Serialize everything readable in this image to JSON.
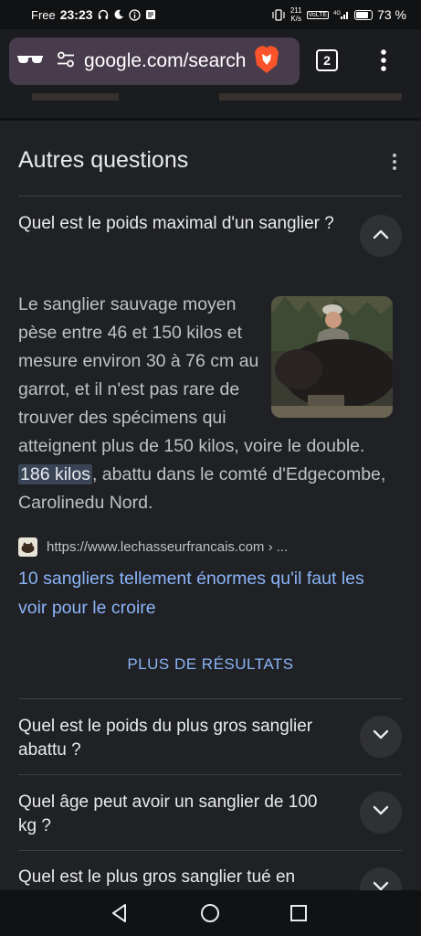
{
  "status_bar": {
    "carrier": "Free",
    "time": "23:23",
    "net_speed_value": "211",
    "net_speed_unit": "K/s",
    "volte": "VoLTE",
    "signal_type": "4G",
    "battery": "73 %"
  },
  "browser": {
    "url": "google.com/search",
    "tab_count": "2"
  },
  "section": {
    "title": "Autres questions"
  },
  "expanded_question": {
    "question": "Quel est le poids maximal d'un sanglier ?",
    "answer_part1": "Le sanglier sauvage moyen pèse entre 46 et 150 kilos et mesure environ 30 à 76 cm au garrot, et il n'est pas rare de trouver des spécimens qui atteignent plus de 150 kilos, voire le double. ",
    "answer_highlight": "186 kilos",
    "answer_part2": ", abattu dans le comté d'Edgecombe, Carolinedu Nord.",
    "source_url": "https://www.lechasseurfrancais.com › ...",
    "source_title": "10 sangliers tellement énormes qu'il faut les voir pour le croire"
  },
  "more_results_label": "PLUS DE RÉSULTATS",
  "questions": [
    "Quel est le poids du plus gros sanglier abattu ?",
    "Quel âge peut avoir un sanglier de 100 kg ?",
    "Quel est le plus gros sanglier tué en"
  ]
}
